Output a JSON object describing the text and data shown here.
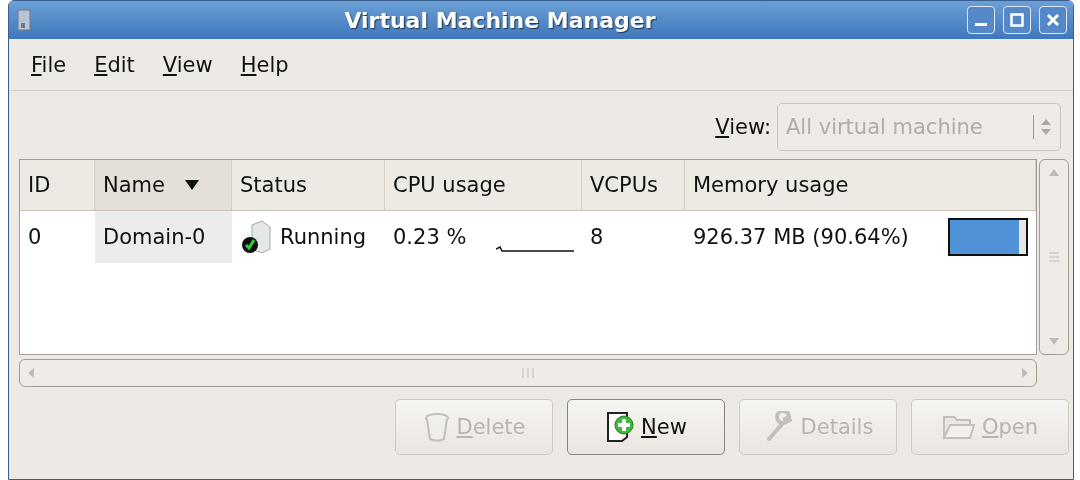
{
  "window": {
    "title": "Virtual Machine Manager"
  },
  "menu": [
    {
      "label": "File",
      "mnemonic": true
    },
    {
      "label": "Edit",
      "mnemonic": true
    },
    {
      "label": "View",
      "mnemonic": true
    },
    {
      "label": "Help",
      "mnemonic": true
    }
  ],
  "view_filter": {
    "label": "View:",
    "mnemonic": true,
    "value": "All virtual machine",
    "disabled": true
  },
  "table": {
    "columns": [
      {
        "label": "ID",
        "sorted": false
      },
      {
        "label": "Name",
        "sorted": true
      },
      {
        "label": "Status",
        "sorted": false
      },
      {
        "label": "CPU usage",
        "sorted": false
      },
      {
        "label": "VCPUs",
        "sorted": false
      },
      {
        "label": "Memory usage",
        "sorted": false
      }
    ],
    "rows": [
      {
        "id": "0",
        "name": "Domain-0",
        "status": "Running",
        "running": true,
        "cpu": "0.23 %",
        "vcpus": "8",
        "memory": "926.37 MB (90.64%)",
        "level": 0.91
      }
    ]
  },
  "buttons": [
    {
      "label": "Delete",
      "mnemonic": true,
      "kind": "delete",
      "disabled": true
    },
    {
      "label": "New",
      "mnemonic": true,
      "kind": "new",
      "disabled": false
    },
    {
      "label": "Details",
      "mnemonic": false,
      "kind": "details",
      "disabled": true
    },
    {
      "label": "Open",
      "mnemonic": true,
      "kind": "open",
      "disabled": true
    }
  ]
}
